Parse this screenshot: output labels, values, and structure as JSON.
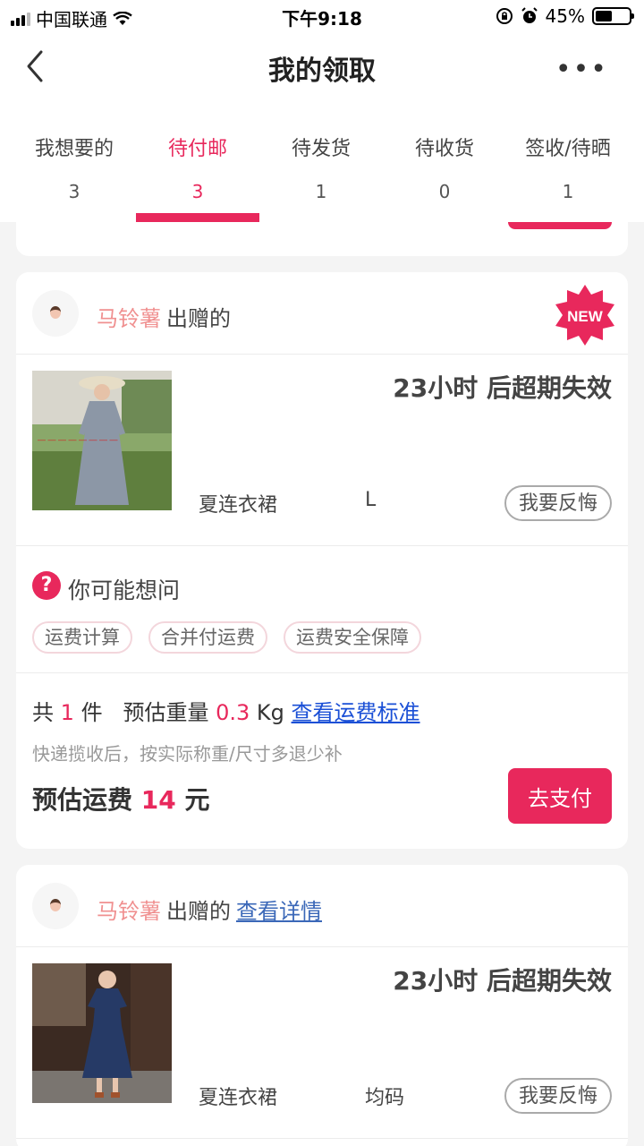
{
  "status_bar": {
    "carrier": "中国联通",
    "time": "下午9:18",
    "battery": "45%"
  },
  "nav": {
    "title": "我的领取"
  },
  "tabs": [
    {
      "label": "我想要的",
      "count": "3"
    },
    {
      "label": "待付邮",
      "count": "3"
    },
    {
      "label": "待发货",
      "count": "1"
    },
    {
      "label": "待收货",
      "count": "0"
    },
    {
      "label": "签收/待晒",
      "count": "1"
    }
  ],
  "cards": [
    {
      "giver": "马铃薯",
      "giver_suffix": "出赠的",
      "badge": "NEW",
      "expire": "23小时 后超期失效",
      "product_name": "夏连衣裙",
      "product_size": "L",
      "regret_label": "我要反悔",
      "faq": {
        "title": "你可能想问",
        "tags": [
          "运费计算",
          "合并付运费",
          "运费安全保障"
        ]
      },
      "pay": {
        "count_prefix": "共",
        "count": "1",
        "count_suffix": "件",
        "weight_label": "预估重量",
        "weight": "0.3",
        "weight_unit": "Kg",
        "standard_link": "查看运费标准",
        "note": "快递揽收后，按实际称重/尺寸多退少补",
        "fee_label": "预估运费",
        "fee": "14",
        "fee_unit": "元",
        "pay_button": "去支付"
      }
    },
    {
      "giver": "马铃薯",
      "giver_suffix": "出赠的",
      "detail_link": "查看详情",
      "expire": "23小时 后超期失效",
      "product_name": "夏连衣裙",
      "product_size": "均码",
      "regret_label": "我要反悔"
    }
  ]
}
